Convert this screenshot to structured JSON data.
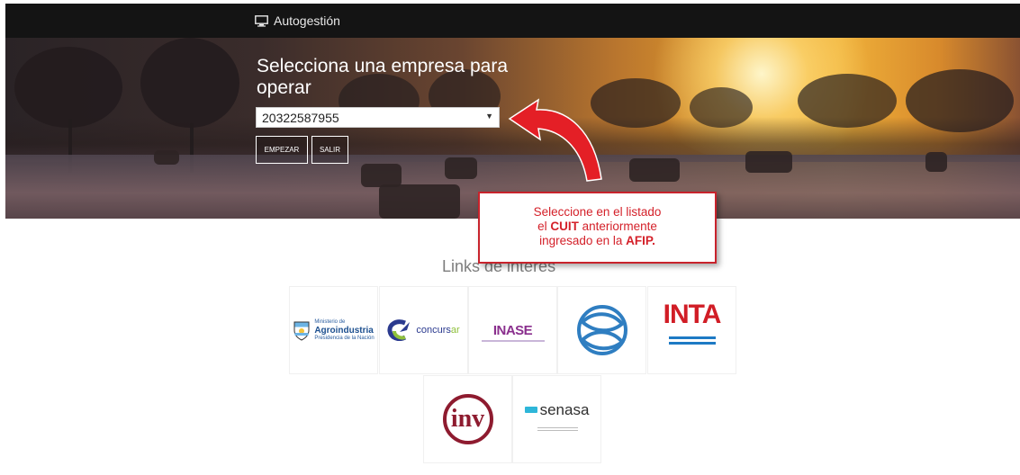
{
  "header": {
    "title": "Autogestión",
    "icon": "monitor-icon"
  },
  "hero": {
    "title": "Selecciona una empresa para operar",
    "company_select": {
      "value": "20322587955"
    },
    "buttons": {
      "start": "EMPEZAR",
      "exit": "SALIR"
    }
  },
  "callout": {
    "text_1": "Seleccione en el listado",
    "text_2a": "el ",
    "text_2b": "CUIT",
    "text_2c": " anteriormente",
    "text_3a": "ingresado en la ",
    "text_3b": "AFIP."
  },
  "links": {
    "title": "Links de interes",
    "items": [
      {
        "name": "Agroindustria",
        "line1": "Ministerio de",
        "line2": "Agroindustria",
        "line3": "Presidencia de la Nación"
      },
      {
        "name": "concursar",
        "word": "concurs",
        "accent": "ar"
      },
      {
        "name": "INASE",
        "word": "INASE"
      },
      {
        "name": "Fish logo"
      },
      {
        "name": "INTA",
        "word": "INTA"
      },
      {
        "name": "INV",
        "word": "inv"
      },
      {
        "name": "senasa",
        "word": "senasa"
      }
    ]
  },
  "colors": {
    "accent_red": "#c8232c",
    "topbar": "#141414"
  }
}
